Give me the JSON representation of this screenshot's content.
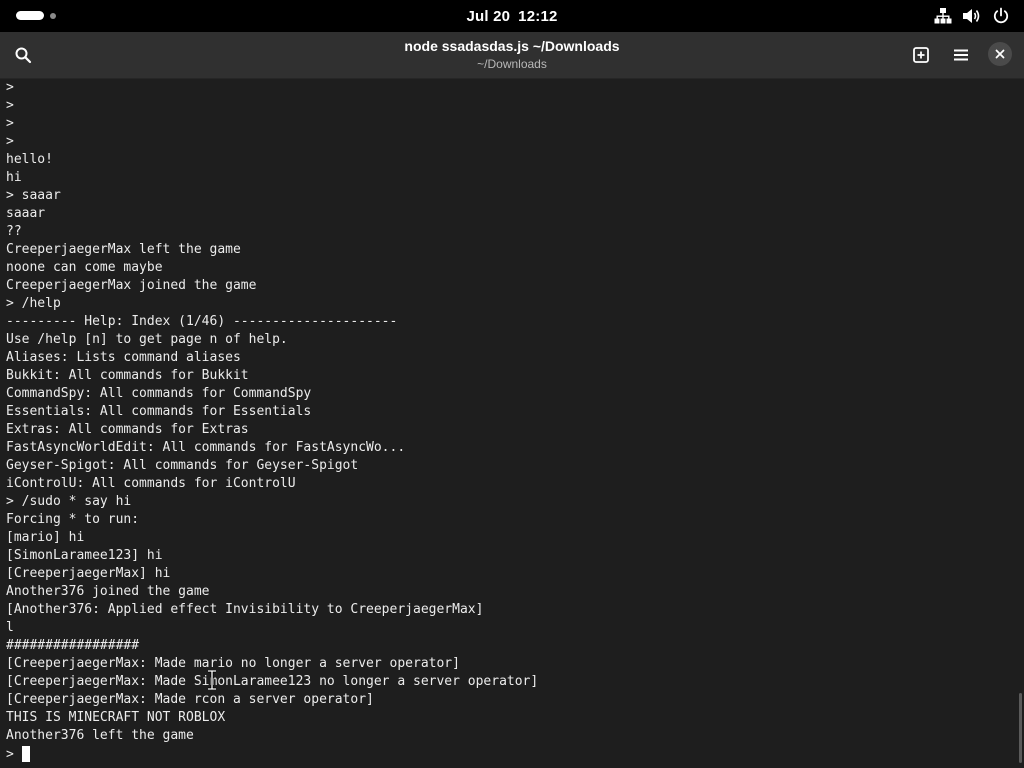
{
  "topbar": {
    "date": "Jul 20",
    "time": "12:12",
    "icons": [
      "network-icon",
      "volume-icon",
      "power-icon"
    ]
  },
  "window": {
    "title": "node ssadasdas.js ~/Downloads",
    "subtitle": "~/Downloads",
    "buttons": [
      "search-icon",
      "new-tab-icon",
      "menu-icon",
      "close-icon"
    ]
  },
  "terminal": {
    "lines": [
      ">",
      ">",
      ">",
      ">",
      "hello!",
      "hi",
      "> saaar",
      "saaar",
      "??",
      "CreeperjaegerMax left the game",
      "noone can come maybe",
      "CreeperjaegerMax joined the game",
      "> /help",
      "--------- Help: Index (1/46) ---------------------",
      "Use /help [n] to get page n of help.",
      "Aliases: Lists command aliases",
      "Bukkit: All commands for Bukkit",
      "CommandSpy: All commands for CommandSpy",
      "Essentials: All commands for Essentials",
      "Extras: All commands for Extras",
      "FastAsyncWorldEdit: All commands for FastAsyncWo...",
      "Geyser-Spigot: All commands for Geyser-Spigot",
      "iControlU: All commands for iControlU",
      "> /sudo * say hi",
      "Forcing * to run:",
      "[mario] hi",
      "[SimonLaramee123] hi",
      "[CreeperjaegerMax] hi",
      "Another376 joined the game",
      "[Another376: Applied effect Invisibility to CreeperjaegerMax]",
      "l",
      "#################",
      "[CreeperjaegerMax: Made mario no longer a server operator]",
      "[CreeperjaegerMax: Made SimonLaramee123 no longer a server operator]",
      "[CreeperjaegerMax: Made rcon a server operator]",
      "THIS IS MINECRAFT NOT ROBLOX",
      "Another376 left the game"
    ],
    "prompt": "> "
  },
  "colors": {
    "topbar_bg": "#000000",
    "headerbar_bg": "#303030",
    "terminal_bg": "#1e1e1e",
    "terminal_fg": "#ececec"
  }
}
